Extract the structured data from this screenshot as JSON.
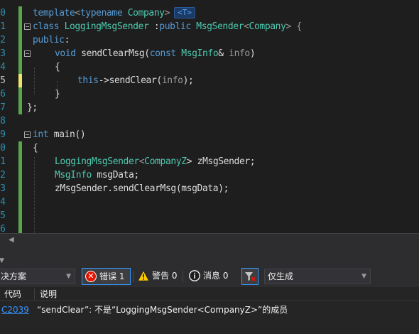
{
  "editor": {
    "line_numbers": [
      "0",
      "1",
      "2",
      "3",
      "4",
      "5",
      "6",
      "7",
      "8",
      "9",
      "0",
      "1",
      "2",
      "3",
      "4",
      "5",
      "6"
    ],
    "current_line_index": 5,
    "lines": {
      "l0": {
        "kw1": "template",
        "p1": "<",
        "kw2": "typename",
        "p2": " ",
        "ty1": "Company",
        "p3": ">",
        "tag": "<T>"
      },
      "l1": {
        "kw1": "class",
        "p1": " ",
        "ty1": "LoggingMsgSender",
        "p2": " :",
        "kw2": "public",
        "p3": " ",
        "ty2": "MsgSender",
        "p4": "<",
        "ty3": "Company",
        "p5": "> {"
      },
      "l2": {
        "kw1": "public",
        "p1": ":"
      },
      "l3": {
        "kw1": "void",
        "p1": " sendClearMsg(",
        "kw2": "const",
        "p2": " ",
        "ty1": "MsgInfo",
        "p3": "& ",
        "pm1": "info",
        "p4": ")"
      },
      "l4": {
        "p1": "{"
      },
      "l5": {
        "kw1": "this",
        "p1": "->sendClear(",
        "pm1": "info",
        "p2": ");"
      },
      "l6": {
        "p1": "}"
      },
      "l7": {
        "p1": "};"
      },
      "l9": {
        "kw1": "int",
        "p1": " main()"
      },
      "l10": {
        "p1": "{"
      },
      "l11": {
        "ty1": "LoggingMsgSender",
        "p1": "<",
        "ty2": "CompanyZ",
        "p2": "> zMsgSender;"
      },
      "l12": {
        "ty1": "MsgInfo",
        "p1": " msgData;"
      },
      "l13": {
        "p1": "zMsgSender.sendClearMsg(msgData);"
      }
    }
  },
  "error_list": {
    "solution_combo": "决方案",
    "errors_label": "错误 1",
    "warnings_label": "警告 0",
    "messages_label": "消息 0",
    "build_filter_combo": "仅生成",
    "columns": {
      "code": "代码",
      "description": "说明"
    },
    "rows": [
      {
        "code": "C2039",
        "description": "“sendClear”: 不是“LoggingMsgSender<CompanyZ>”的成员"
      }
    ]
  },
  "colors": {
    "background": "#1e1e1e",
    "keyword": "#569cd6",
    "type": "#4ec9b0",
    "change_bar_saved": "#57a64a",
    "change_bar_unsaved": "#efe56b",
    "error_red": "#e51400"
  }
}
